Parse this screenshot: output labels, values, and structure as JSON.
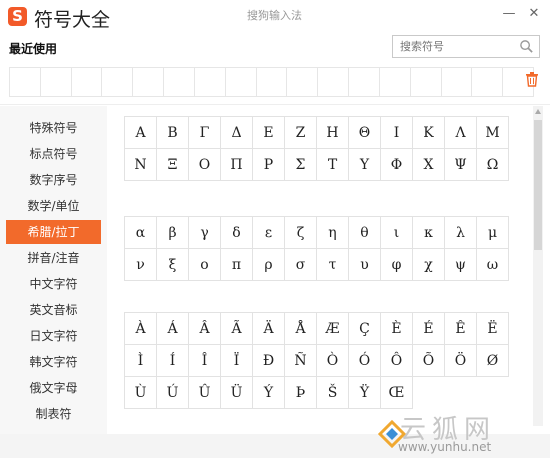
{
  "app": {
    "logo": "S",
    "title": "符号大全",
    "subtitle": "搜狗输入法"
  },
  "window": {
    "minimize": "—",
    "close": "✕"
  },
  "recent": {
    "label": "最近使用",
    "cells": 17
  },
  "search": {
    "placeholder": "搜索符号"
  },
  "sidebar": {
    "items": [
      {
        "label": "特殊符号"
      },
      {
        "label": "标点符号"
      },
      {
        "label": "数字序号"
      },
      {
        "label": "数学/单位"
      },
      {
        "label": "希腊/拉丁"
      },
      {
        "label": "拼音/注音"
      },
      {
        "label": "中文字符"
      },
      {
        "label": "英文音标"
      },
      {
        "label": "日文字符"
      },
      {
        "label": "韩文字符"
      },
      {
        "label": "俄文字母"
      },
      {
        "label": "制表符"
      }
    ],
    "active_index": 4
  },
  "colors": {
    "accent": "#f26a2b",
    "logo": "#f25a29"
  },
  "sections": [
    {
      "symbols": [
        "Α",
        "Β",
        "Γ",
        "Δ",
        "Ε",
        "Ζ",
        "Η",
        "Θ",
        "Ι",
        "Κ",
        "Λ",
        "Μ",
        "Ν",
        "Ξ",
        "Ο",
        "Π",
        "Ρ",
        "Σ",
        "Τ",
        "Υ",
        "Φ",
        "Χ",
        "Ψ",
        "Ω"
      ]
    },
    {
      "symbols": [
        "α",
        "β",
        "γ",
        "δ",
        "ε",
        "ζ",
        "η",
        "θ",
        "ι",
        "κ",
        "λ",
        "μ",
        "ν",
        "ξ",
        "ο",
        "π",
        "ρ",
        "σ",
        "τ",
        "υ",
        "φ",
        "χ",
        "ψ",
        "ω"
      ]
    },
    {
      "symbols": [
        "À",
        "Á",
        "Â",
        "Ã",
        "Ä",
        "Å",
        "Æ",
        "Ç",
        "È",
        "É",
        "Ê",
        "Ë",
        "Ì",
        "Í",
        "Î",
        "Ï",
        "Ð",
        "Ñ",
        "Ò",
        "Ó",
        "Ô",
        "Õ",
        "Ö",
        "Ø",
        "Ù",
        "Ú",
        "Û",
        "Ü",
        "Ý",
        "Þ",
        "Š",
        "Ÿ",
        "Œ"
      ]
    }
  ],
  "watermark": {
    "text": "云狐网",
    "url": "www.yunhu.net"
  }
}
